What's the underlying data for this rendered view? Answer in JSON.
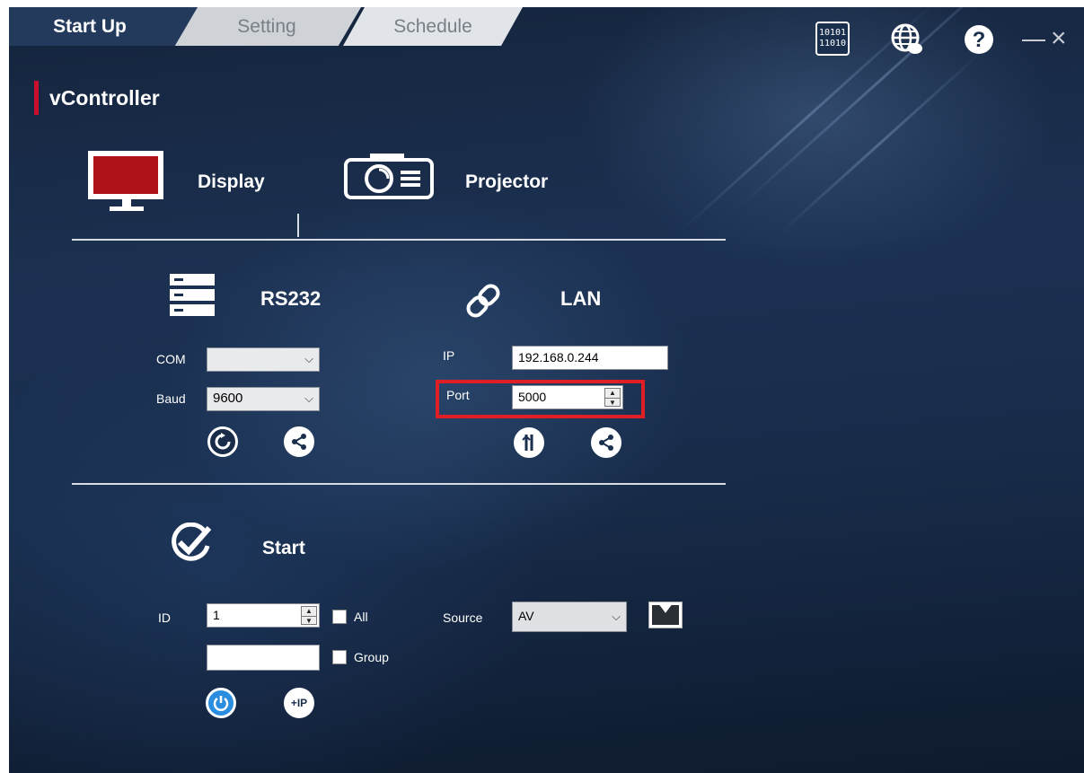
{
  "tabs": [
    {
      "label": "Start Up",
      "active": true
    },
    {
      "label": "Setting",
      "active": false
    },
    {
      "label": "Schedule",
      "active": false
    }
  ],
  "app_name": "vController",
  "window_icons": [
    "binary-icon",
    "globe-icon",
    "help-icon",
    "minimize-icon",
    "close-icon"
  ],
  "binary_icon_text": [
    "10101",
    "11010"
  ],
  "device_types": [
    {
      "label": "Display",
      "icon": "monitor-icon",
      "selected": true
    },
    {
      "label": "Projector",
      "icon": "projector-icon",
      "selected": false
    }
  ],
  "rs232": {
    "heading": "RS232",
    "com_label": "COM",
    "com_value": "",
    "baud_label": "Baud",
    "baud_value": "9600"
  },
  "lan": {
    "heading": "LAN",
    "ip_label": "IP",
    "ip_value": "192.168.0.244",
    "port_label": "Port",
    "port_value": "5000"
  },
  "start": {
    "heading": "Start",
    "id_label": "ID",
    "id_value": "1",
    "all_label": "All",
    "group_label": "Group",
    "group_value": "",
    "source_label": "Source",
    "source_value": "AV",
    "ip_button_label": "+IP"
  },
  "colors": {
    "accent_red": "#c8102e",
    "highlight_red": "#e01e26",
    "power_blue": "#2b8de0",
    "tab_active": "#233a5c"
  }
}
